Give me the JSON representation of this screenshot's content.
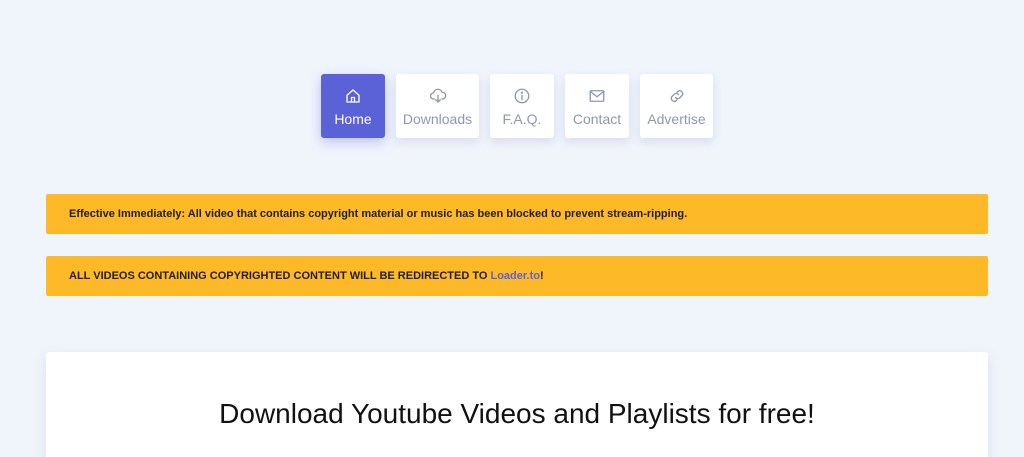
{
  "nav": {
    "items": [
      {
        "label": "Home",
        "icon": "home-icon",
        "active": true
      },
      {
        "label": "Downloads",
        "icon": "cloud-download-icon",
        "active": false
      },
      {
        "label": "F.A.Q.",
        "icon": "info-icon",
        "active": false
      },
      {
        "label": "Contact",
        "icon": "mail-icon",
        "active": false
      },
      {
        "label": "Advertise",
        "icon": "link-icon",
        "active": false
      }
    ]
  },
  "notices": {
    "first": "Effective Immediately: All video that contains copyright material or music has been blocked to prevent stream-ripping.",
    "second_prefix": "ALL VIDEOS CONTAINING COPYRIGHTED CONTENT WILL BE REDIRECTED TO ",
    "second_link": "Loader.to",
    "second_suffix": "!"
  },
  "main": {
    "title": "Download Youtube Videos and Playlists for free!"
  },
  "colors": {
    "background": "#f0f5fc",
    "accent": "#5b61d6",
    "notice": "#fdb927",
    "nav_text": "#8e97b5"
  }
}
